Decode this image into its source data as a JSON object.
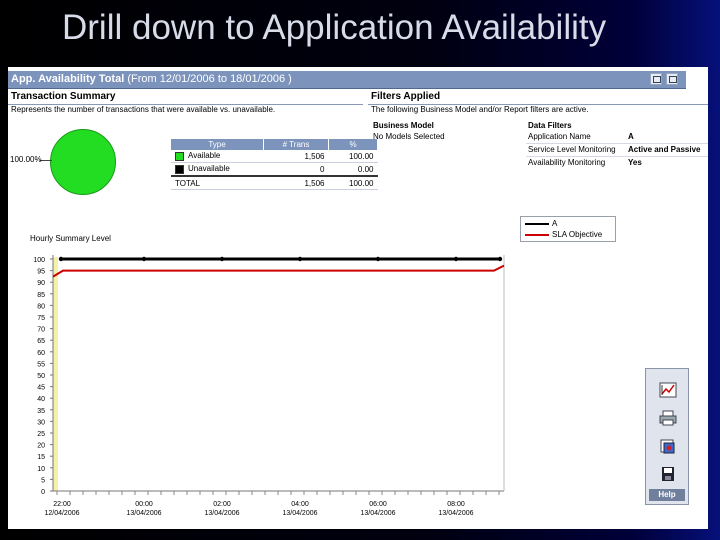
{
  "slide": {
    "title": "Drill down to Application Availability"
  },
  "report": {
    "header_title": "App. Availability Total",
    "header_range": "(From 12/01/2006 to 18/01/2006 )"
  },
  "summary": {
    "title": "Transaction Summary",
    "description": "Represents the number of transactions that were available vs. unavailable.",
    "pie_label": "100.00%",
    "table": {
      "headers": [
        "Type",
        "# Trans",
        "%"
      ],
      "rows": [
        {
          "type": "Available",
          "trans": "1,506",
          "pct": "100.00",
          "color": "#22dd22"
        },
        {
          "type": "Unavailable",
          "trans": "0",
          "pct": "0.00",
          "color": "#000000"
        }
      ],
      "total": {
        "type": "TOTAL",
        "trans": "1,506",
        "pct": "100.00"
      }
    }
  },
  "filters": {
    "title": "Filters Applied",
    "description": "The following Business Model and/or Report filters are active.",
    "business_model_header": "Business Model",
    "business_model_value": "No Models Selected",
    "data_filters_header": "Data Filters",
    "items": [
      {
        "name": "Application Name",
        "value": "A"
      },
      {
        "name": "Service Level Monitoring",
        "value": "Active and Passive"
      },
      {
        "name": "Availability Monitoring",
        "value": "Yes"
      }
    ]
  },
  "chart_data": {
    "type": "line",
    "title": "Hourly Summary Level",
    "x": [
      "22:00 12/04/2006",
      "00:00 13/04/2006",
      "02:00 13/04/2006",
      "04:00 13/04/2006",
      "06:00 13/04/2006",
      "08:00 13/04/2006"
    ],
    "series": [
      {
        "name": "A",
        "values": [
          100,
          100,
          100,
          100,
          100,
          100
        ],
        "color": "#000000"
      },
      {
        "name": "SLA Objective",
        "values": [
          95,
          95,
          95,
          95,
          95,
          95
        ],
        "color": "#cc0000"
      }
    ],
    "y_ticks": [
      "100",
      "95",
      "90",
      "85",
      "80",
      "75",
      "70",
      "65",
      "60",
      "55",
      "50",
      "45",
      "40",
      "35",
      "30",
      "25",
      "20",
      "15",
      "10",
      "5",
      "0"
    ],
    "x_ticks": [
      {
        "time": "22:00",
        "date": "12/04/2006"
      },
      {
        "time": "00:00",
        "date": "13/04/2006"
      },
      {
        "time": "02:00",
        "date": "13/04/2006"
      },
      {
        "time": "04:00",
        "date": "13/04/2006"
      },
      {
        "time": "06:00",
        "date": "13/04/2006"
      },
      {
        "time": "08:00",
        "date": "13/04/2006"
      }
    ],
    "ylim": [
      0,
      100
    ],
    "legend": {
      "placement": "top-right",
      "items": [
        "A",
        "SLA Objective"
      ]
    }
  },
  "toolbar": {
    "help_label": "Help"
  },
  "icons": {
    "chart": "chart-icon",
    "print": "printer-icon",
    "export": "export-icon",
    "save": "floppy-disk-icon",
    "header_a": "report-options-icon",
    "header_b": "report-close-icon"
  }
}
